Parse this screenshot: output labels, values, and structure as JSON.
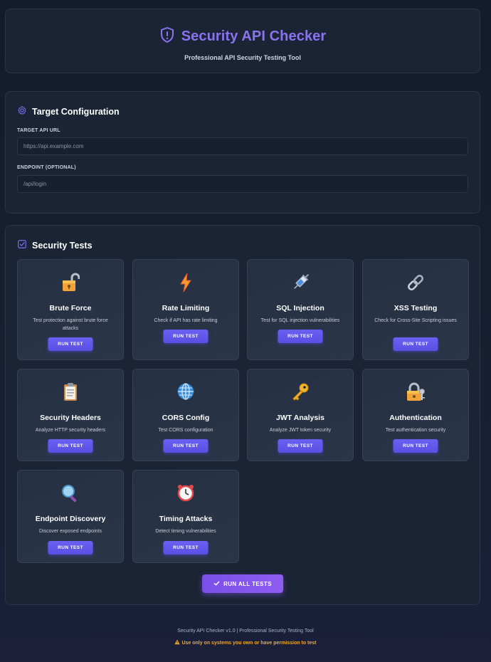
{
  "header": {
    "title": "Security API Checker",
    "subtitle": "Professional API Security Testing Tool",
    "icon": "shield-icon"
  },
  "config": {
    "title": "Target Configuration",
    "icon": "gear-icon",
    "url_label": "TARGET API URL",
    "url_placeholder": "https://api.example.com",
    "endpoint_label": "ENDPOINT (OPTIONAL)",
    "endpoint_placeholder": "/api/login"
  },
  "tests": {
    "title": "Security Tests",
    "icon": "checkbox-icon",
    "items": [
      {
        "name": "Brute Force",
        "desc": "Test protection against brute force attacks",
        "icon": "unlocked-padlock-icon",
        "button": "RUN TEST"
      },
      {
        "name": "Rate Limiting",
        "desc": "Check if API has rate limiting",
        "icon": "lightning-icon",
        "button": "RUN TEST"
      },
      {
        "name": "SQL Injection",
        "desc": "Test for SQL injection vulnerabilities",
        "icon": "syringe-icon",
        "button": "RUN TEST"
      },
      {
        "name": "XSS Testing",
        "desc": "Check for Cross-Site Scripting issues",
        "icon": "link-icon",
        "button": "RUN TEST"
      },
      {
        "name": "Security Headers",
        "desc": "Analyze HTTP security headers",
        "icon": "clipboard-icon",
        "button": "RUN TEST"
      },
      {
        "name": "CORS Config",
        "desc": "Test CORS configuration",
        "icon": "globe-icon",
        "button": "RUN TEST"
      },
      {
        "name": "JWT Analysis",
        "desc": "Analyze JWT token security",
        "icon": "key-icon",
        "button": "RUN TEST"
      },
      {
        "name": "Authentication",
        "desc": "Test authentication security",
        "icon": "lock-with-key-icon",
        "button": "RUN TEST"
      },
      {
        "name": "Endpoint Discovery",
        "desc": "Discover exposed endpoints",
        "icon": "magnifier-icon",
        "button": "RUN TEST"
      },
      {
        "name": "Timing Attacks",
        "desc": "Detect timing vulnerabilities",
        "icon": "alarm-clock-icon",
        "button": "RUN TEST"
      }
    ],
    "run_all": "RUN ALL TESTS",
    "run_all_icon": "checkmark-icon"
  },
  "footer": {
    "line1": "Security API Checker v1.0 | Professional Security Testing Tool",
    "line2": "Use only on systems you own or have permission to test",
    "warning_icon": "warning-icon"
  },
  "colors": {
    "accent": "#8b72f0",
    "button": "#5f55ea",
    "warning": "#f0a72a"
  }
}
